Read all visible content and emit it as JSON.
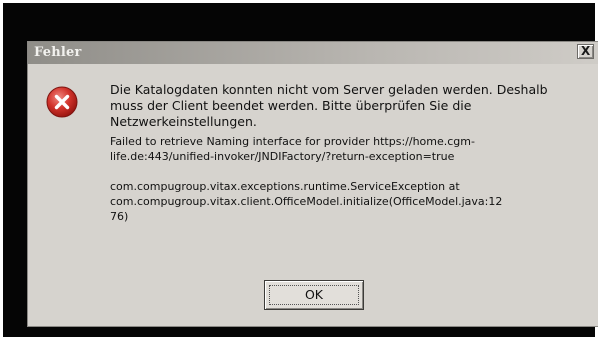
{
  "dialog": {
    "title": "Fehler",
    "close_glyph": "X",
    "icon": "error-icon",
    "message_lines": [
      "Die Katalogdaten konnten nicht vom Server geladen werden. Deshalb",
      "muss der Client beendet werden. Bitte überprüfen Sie die",
      "Netzwerkeinstellungen."
    ],
    "detail_lines": [
      "Failed to retrieve Naming interface for provider https://home.cgm-",
      "life.de:443/unified-invoker/JNDIFactory/?return-exception=true"
    ],
    "exception_lines": [
      "com.compugroup.vitax.exceptions.runtime.ServiceException at",
      "com.compugroup.vitax.client.OfficeModel.initialize(OfficeModel.java:12",
      "76)"
    ],
    "ok_label": "OK"
  },
  "colors": {
    "background": "#050505",
    "dialog_face": "#d6d3ce",
    "error_red": "#c0201c"
  }
}
